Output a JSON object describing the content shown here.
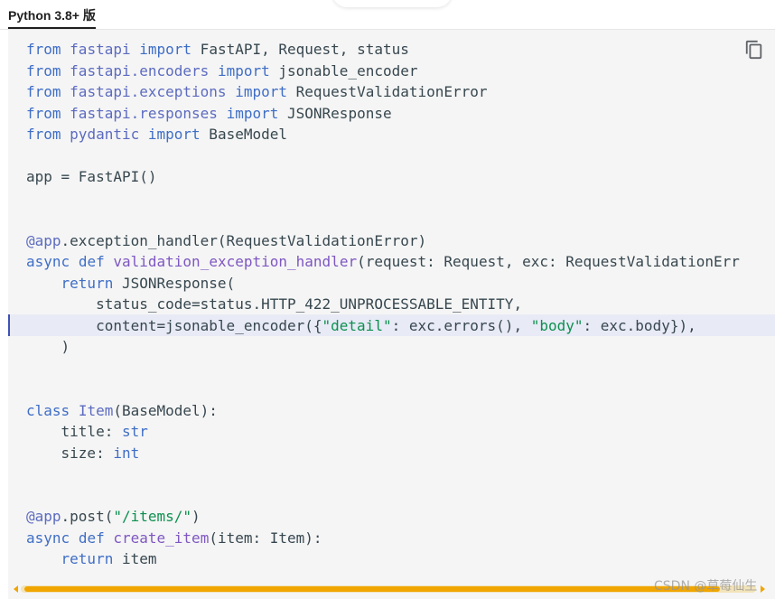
{
  "tab": {
    "label": "Python 3.8+ 版"
  },
  "toolbar": {
    "copy_icon": "copy-icon"
  },
  "code": {
    "highlighted_line": 14,
    "lines": [
      {
        "tokens": [
          {
            "t": "from",
            "c": "kw"
          },
          {
            "t": " "
          },
          {
            "t": "fastapi",
            "c": "mod"
          },
          {
            "t": " "
          },
          {
            "t": "import",
            "c": "kw"
          },
          {
            "t": " FastAPI, Request, status"
          }
        ]
      },
      {
        "tokens": [
          {
            "t": "from",
            "c": "kw"
          },
          {
            "t": " "
          },
          {
            "t": "fastapi.encoders",
            "c": "mod"
          },
          {
            "t": " "
          },
          {
            "t": "import",
            "c": "kw"
          },
          {
            "t": " jsonable_encoder"
          }
        ]
      },
      {
        "tokens": [
          {
            "t": "from",
            "c": "kw"
          },
          {
            "t": " "
          },
          {
            "t": "fastapi.exceptions",
            "c": "mod"
          },
          {
            "t": " "
          },
          {
            "t": "import",
            "c": "kw"
          },
          {
            "t": " RequestValidationError"
          }
        ]
      },
      {
        "tokens": [
          {
            "t": "from",
            "c": "kw"
          },
          {
            "t": " "
          },
          {
            "t": "fastapi.responses",
            "c": "mod"
          },
          {
            "t": " "
          },
          {
            "t": "import",
            "c": "kw"
          },
          {
            "t": " JSONResponse"
          }
        ]
      },
      {
        "tokens": [
          {
            "t": "from",
            "c": "kw"
          },
          {
            "t": " "
          },
          {
            "t": "pydantic",
            "c": "mod"
          },
          {
            "t": " "
          },
          {
            "t": "import",
            "c": "kw"
          },
          {
            "t": " BaseModel"
          }
        ]
      },
      {
        "tokens": []
      },
      {
        "tokens": [
          {
            "t": "app = FastAPI()"
          }
        ]
      },
      {
        "tokens": []
      },
      {
        "tokens": []
      },
      {
        "tokens": [
          {
            "t": "@app",
            "c": "dec"
          },
          {
            "t": ".exception_handler(RequestValidationError)"
          }
        ]
      },
      {
        "tokens": [
          {
            "t": "async",
            "c": "kw"
          },
          {
            "t": " "
          },
          {
            "t": "def",
            "c": "kw"
          },
          {
            "t": " "
          },
          {
            "t": "validation_exception_handler",
            "c": "fn"
          },
          {
            "t": "(request: Request, exc: RequestValidationErr"
          }
        ]
      },
      {
        "tokens": [
          {
            "t": "    "
          },
          {
            "t": "return",
            "c": "kw"
          },
          {
            "t": " JSONResponse("
          }
        ]
      },
      {
        "tokens": [
          {
            "t": "        status_code=status.HTTP_422_UNPROCESSABLE_ENTITY,"
          }
        ]
      },
      {
        "tokens": [
          {
            "t": "        content=jsonable_encoder({"
          },
          {
            "t": "\"detail\"",
            "c": "str"
          },
          {
            "t": ": exc.errors(), "
          },
          {
            "t": "\"body\"",
            "c": "str"
          },
          {
            "t": ": exc.body}),"
          }
        ]
      },
      {
        "tokens": [
          {
            "t": "    )"
          }
        ]
      },
      {
        "tokens": []
      },
      {
        "tokens": []
      },
      {
        "tokens": [
          {
            "t": "class",
            "c": "kw"
          },
          {
            "t": " "
          },
          {
            "t": "Item",
            "c": "cls"
          },
          {
            "t": "(BaseModel):"
          }
        ]
      },
      {
        "tokens": [
          {
            "t": "    title: "
          },
          {
            "t": "str",
            "c": "bi"
          }
        ]
      },
      {
        "tokens": [
          {
            "t": "    size: "
          },
          {
            "t": "int",
            "c": "bi"
          }
        ]
      },
      {
        "tokens": []
      },
      {
        "tokens": []
      },
      {
        "tokens": [
          {
            "t": "@app",
            "c": "dec"
          },
          {
            "t": ".post("
          },
          {
            "t": "\"/items/\"",
            "c": "str"
          },
          {
            "t": ")"
          }
        ]
      },
      {
        "tokens": [
          {
            "t": "async",
            "c": "kw"
          },
          {
            "t": " "
          },
          {
            "t": "def",
            "c": "kw"
          },
          {
            "t": " "
          },
          {
            "t": "create_item",
            "c": "fn"
          },
          {
            "t": "(item: Item):"
          }
        ]
      },
      {
        "tokens": [
          {
            "t": "    "
          },
          {
            "t": "return",
            "c": "kw"
          },
          {
            "t": " item"
          }
        ]
      }
    ]
  },
  "scrollbar": {
    "horizontal_position": 0.0
  },
  "watermark": {
    "text": "CSDN @草莓仙生"
  }
}
